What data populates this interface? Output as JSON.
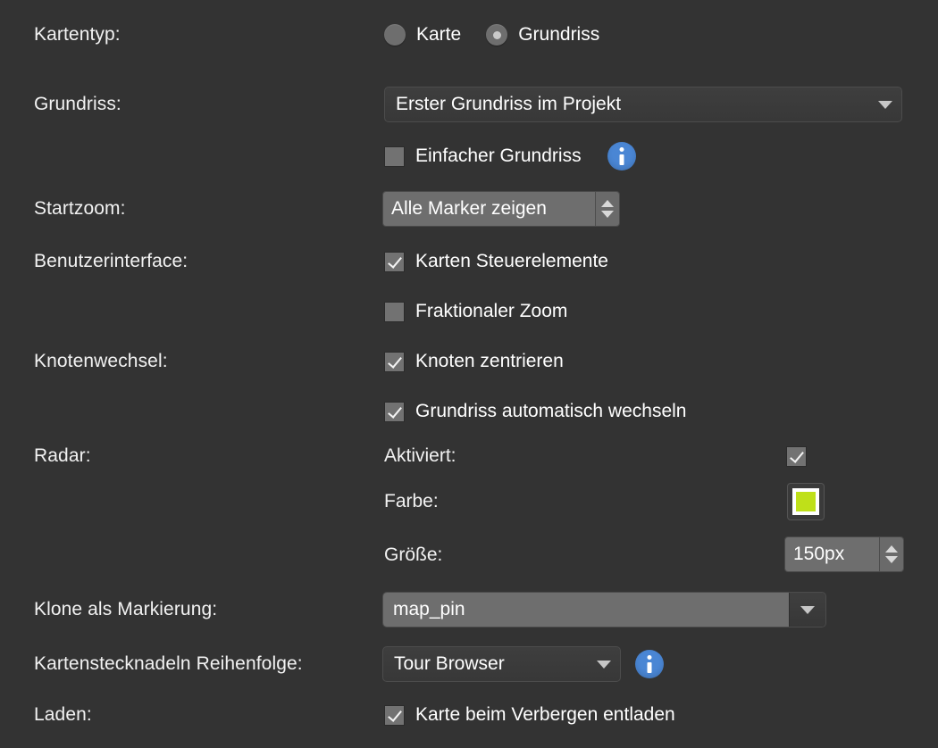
{
  "theme": {
    "background": "#333333",
    "text": "#ffffff",
    "accent_blue": "#4a86d4",
    "field_light": "#6e6e6e",
    "field_dark": "#3b3b3b"
  },
  "rows": {
    "map_type": {
      "label": "Kartentyp:",
      "options": [
        {
          "label": "Karte",
          "selected": false
        },
        {
          "label": "Grundriss",
          "selected": true
        }
      ]
    },
    "floorplan": {
      "label": "Grundriss:",
      "dropdown_value": "Erster Grundriss im Projekt",
      "simple_checkbox": {
        "label": "Einfacher Grundriss",
        "checked": false
      },
      "info_icon": "info-icon"
    },
    "startzoom": {
      "label": "Startzoom:",
      "value": "Alle Marker zeigen"
    },
    "user_interface": {
      "label": "Benutzerinterface:",
      "checkboxes": [
        {
          "label": "Karten Steuerelemente",
          "checked": true
        },
        {
          "label": "Fraktionaler Zoom",
          "checked": false
        }
      ]
    },
    "node_change": {
      "label": "Knotenwechsel:",
      "checkboxes": [
        {
          "label": "Knoten zentrieren",
          "checked": true
        },
        {
          "label": "Grundriss automatisch wechseln",
          "checked": true
        }
      ]
    },
    "radar": {
      "label": "Radar:",
      "enabled": {
        "label": "Aktiviert:",
        "checked": true
      },
      "color": {
        "label": "Farbe:",
        "value": "#bfe019"
      },
      "size": {
        "label": "Größe:",
        "value": "150px"
      }
    },
    "clone_marker": {
      "label": "Klone als Markierung:",
      "value": "map_pin"
    },
    "pin_order": {
      "label": "Kartenstecknadeln Reihenfolge:",
      "value": "Tour Browser",
      "info_icon": "info-icon"
    },
    "loading": {
      "label": "Laden:",
      "checkbox": {
        "label": "Karte beim Verbergen entladen",
        "checked": true
      }
    }
  }
}
